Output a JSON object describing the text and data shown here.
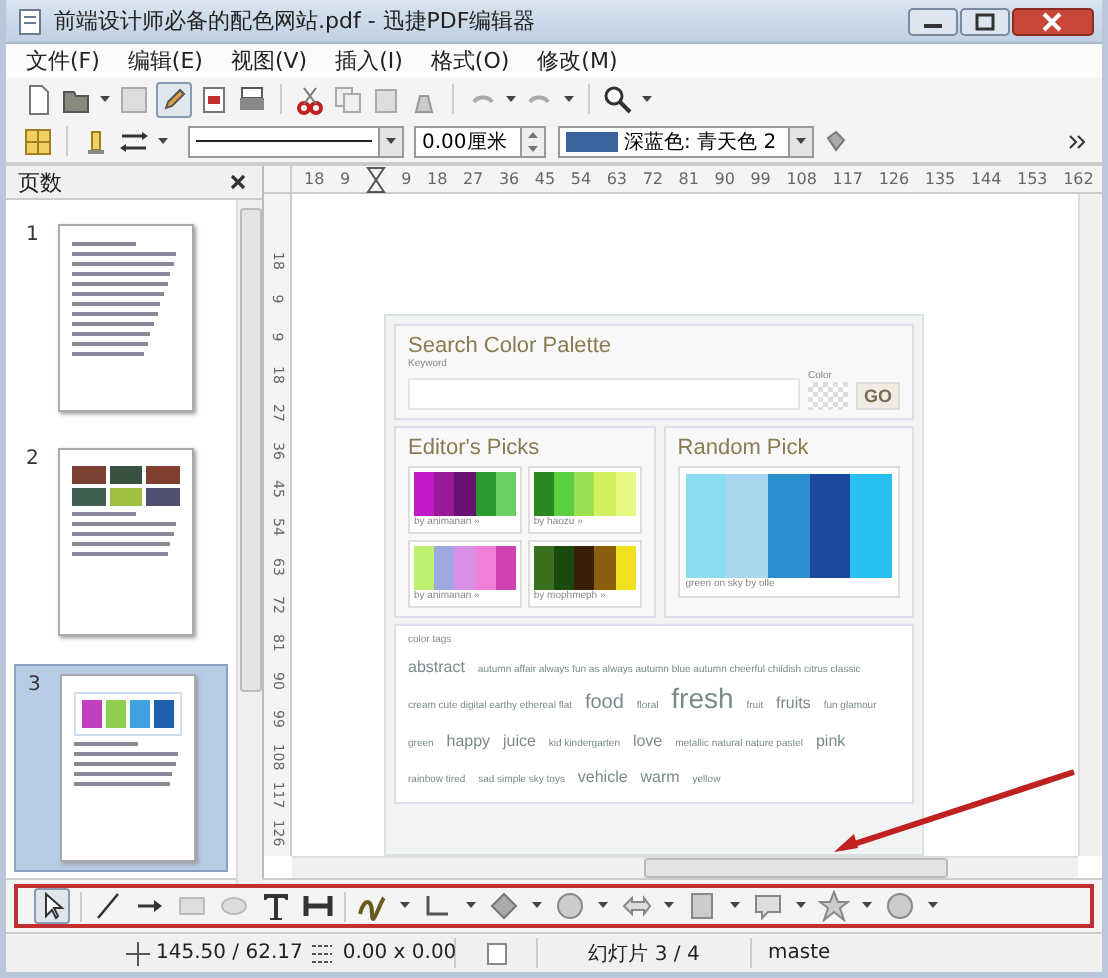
{
  "window": {
    "title": "前端设计师必备的配色网站.pdf - 迅捷PDF编辑器"
  },
  "menu": [
    "文件(F)",
    "编辑(E)",
    "视图(V)",
    "插入(I)",
    "格式(O)",
    "修改(M)"
  ],
  "format_bar": {
    "line_width": "0.00厘米",
    "fill_color": "深蓝色: 青天色 2"
  },
  "pages_panel": {
    "title": "页数",
    "pages": [
      {
        "number": "1",
        "kind": "text",
        "selected": false
      },
      {
        "number": "2",
        "kind": "grid",
        "selected": false
      },
      {
        "number": "3",
        "kind": "palette",
        "selected": true
      }
    ]
  },
  "ruler": {
    "horizontal": [
      "18",
      "9",
      "9",
      "18",
      "27",
      "36",
      "45",
      "54",
      "63",
      "72",
      "81",
      "90",
      "99",
      "108",
      "117",
      "126",
      "135",
      "144",
      "153",
      "162"
    ],
    "vertical": [
      "18",
      "9",
      "9",
      "18",
      "27",
      "36",
      "45",
      "54",
      "63",
      "72",
      "81",
      "90",
      "99",
      "108",
      "117",
      "126"
    ]
  },
  "slide": {
    "search": {
      "title": "Search Color Palette",
      "keyword_label": "Keyword",
      "color_label": "Color",
      "button": "GO"
    },
    "editors_picks": {
      "title": "Editor's Picks",
      "picks": [
        {
          "caption": "by animanan »",
          "swatches": [
            {
              "color": "#c21ac8"
            },
            {
              "color": "#9a1a9a"
            },
            {
              "color": "#6a1070"
            },
            {
              "color": "#2a9a30"
            },
            {
              "color": "#6ad060"
            }
          ]
        },
        {
          "caption": "by haozu »",
          "swatches": [
            {
              "color": "#2a8a20"
            },
            {
              "color": "#5ad040"
            },
            {
              "color": "#9ae050"
            },
            {
              "color": "#d0f060"
            },
            {
              "color": "#e8f880"
            }
          ]
        },
        {
          "caption": "by animanan »",
          "swatches": [
            {
              "color": "#c0f070"
            },
            {
              "color": "#a0a8e0"
            },
            {
              "color": "#d890e8"
            },
            {
              "color": "#f080d8"
            },
            {
              "color": "#d040b0"
            }
          ]
        },
        {
          "caption": "by mophmeph »",
          "swatches": [
            {
              "color": "#3a7020"
            },
            {
              "color": "#1a4a10"
            },
            {
              "color": "#3a2008"
            },
            {
              "color": "#8a6010"
            },
            {
              "color": "#f0e020"
            }
          ]
        }
      ]
    },
    "random_pick": {
      "title": "Random Pick",
      "caption": "green on sky by olle",
      "swatches": [
        {
          "color": "#8adcf0"
        },
        {
          "color": "#a8d8f0"
        },
        {
          "color": "#2a90d0"
        },
        {
          "color": "#1a48a0"
        },
        {
          "color": "#28c0f0"
        }
      ]
    },
    "tags": {
      "title": "color tags",
      "words": [
        {
          "text": "abstract",
          "kind": "medium"
        },
        {
          "text": "autumn affair always fun as always autumn blue autumn cheerful childish citrus classic",
          "kind": "small"
        },
        {
          "text": "cream cute digital earthy ethereal flat",
          "kind": "small"
        },
        {
          "text": "food",
          "kind": "large"
        },
        {
          "text": "floral",
          "kind": "small"
        },
        {
          "text": "fresh",
          "kind": "huge"
        },
        {
          "text": "fruit",
          "kind": "small"
        },
        {
          "text": "fruits",
          "kind": "medium"
        },
        {
          "text": "fun glamour",
          "kind": "small"
        },
        {
          "text": "green",
          "kind": "small"
        },
        {
          "text": "happy",
          "kind": "medium"
        },
        {
          "text": "juice",
          "kind": "medium"
        },
        {
          "text": "kid kindergarten",
          "kind": "small"
        },
        {
          "text": "love",
          "kind": "medium"
        },
        {
          "text": "metallic natural nature pastel",
          "kind": "small"
        },
        {
          "text": "pink",
          "kind": "medium"
        },
        {
          "text": "rainbow tired",
          "kind": "small"
        },
        {
          "text": "sad simple sky toys",
          "kind": "small"
        },
        {
          "text": "vehicle",
          "kind": "medium"
        },
        {
          "text": "warm",
          "kind": "medium"
        },
        {
          "text": "yellow",
          "kind": "small"
        }
      ]
    }
  },
  "status_bar": {
    "position": "145.50 / 62.17",
    "size": "0.00 x 0.00",
    "slide": "幻灯片 3 / 4",
    "master": "maste"
  }
}
